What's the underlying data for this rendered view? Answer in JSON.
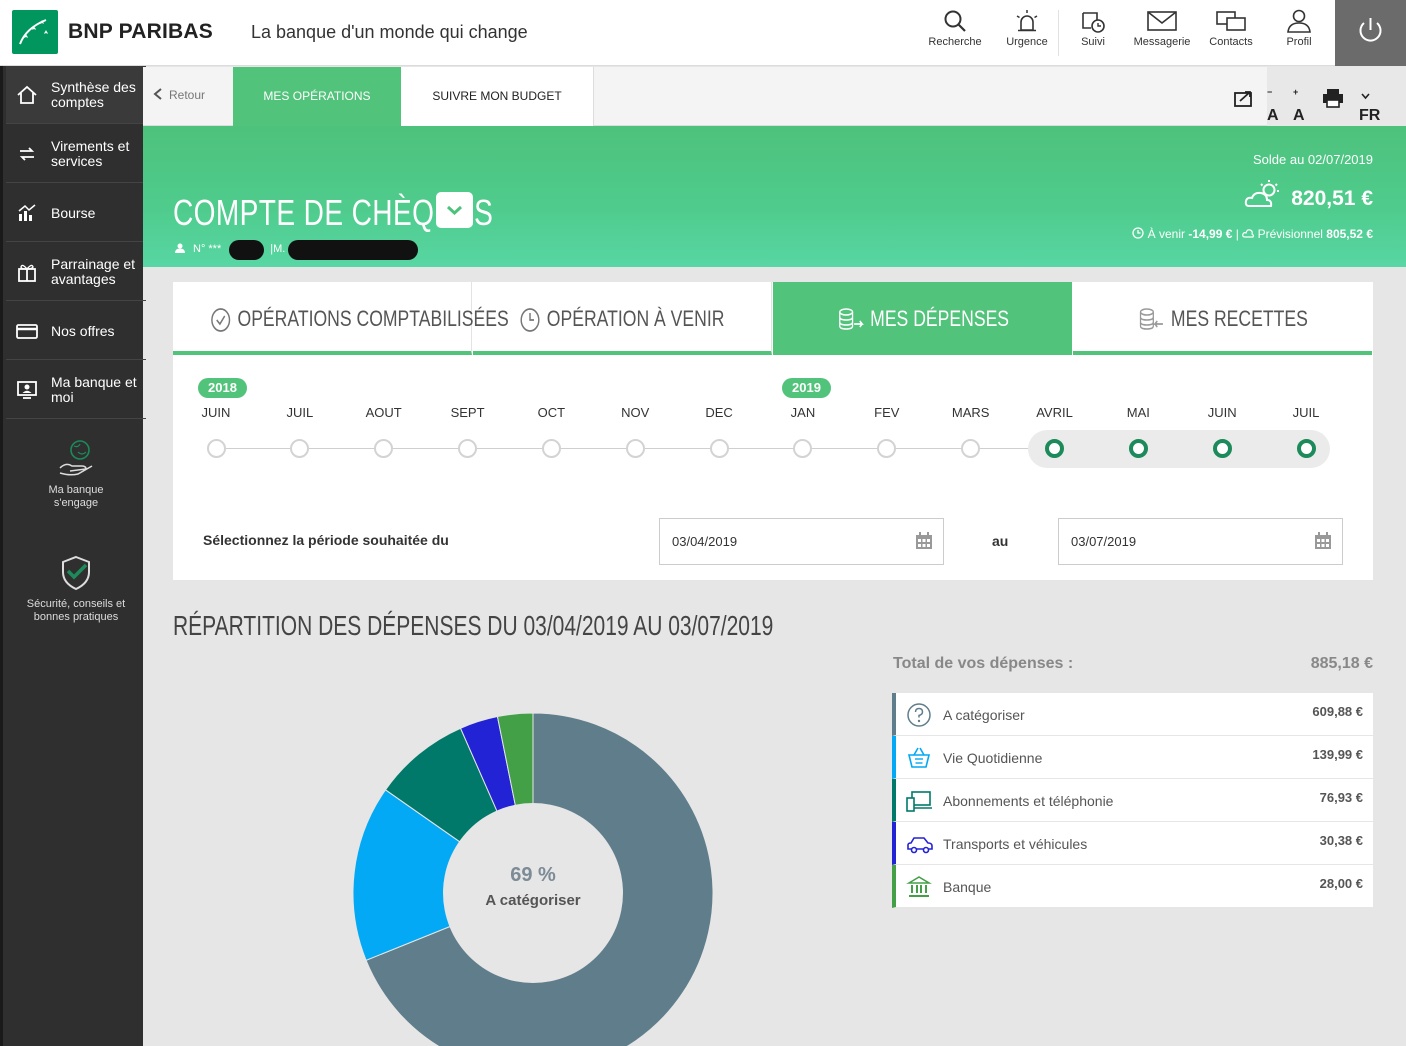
{
  "header": {
    "brand": "BNP PARIBAS",
    "tagline": "La banque d'un monde qui change",
    "nav": [
      {
        "label": "Recherche",
        "icon": "search-icon"
      },
      {
        "label": "Urgence",
        "icon": "alarm-icon"
      },
      {
        "label": "Suivi",
        "icon": "tracking-icon"
      },
      {
        "label": "Messagerie",
        "icon": "mail-icon"
      },
      {
        "label": "Contacts",
        "icon": "chat-icon"
      },
      {
        "label": "Profil",
        "icon": "user-icon"
      }
    ]
  },
  "sidebar": {
    "items": [
      {
        "label": "Synthèse des comptes",
        "icon": "home-icon"
      },
      {
        "label": "Virements et services",
        "icon": "transfer-icon"
      },
      {
        "label": "Bourse",
        "icon": "stock-chart-icon"
      },
      {
        "label": "Parrainage et avantages",
        "icon": "gift-icon"
      },
      {
        "label": "Nos offres",
        "icon": "card-icon"
      },
      {
        "label": "Ma banque et moi",
        "icon": "person-screen-icon"
      }
    ],
    "engage": "Ma banque s'engage",
    "security": "Sécurité, conseils et bonnes pratiques"
  },
  "subbar": {
    "back": "Retour",
    "tab_ops": "MES OPÉRATIONS",
    "tab_budget": "SUIVRE MON BUDGET",
    "font_small": "A",
    "font_big": "A",
    "lang": "FR"
  },
  "account": {
    "title": "COMPTE DE CHÈQUES",
    "num_prefix": "N° ***",
    "num_sep": "|M.",
    "solde_label": "Solde au 02/07/2019",
    "solde_value": "820,51 €",
    "avenir_label": "À venir",
    "avenir_value": "-14,99 €",
    "previsionnel_label": "Prévisionnel",
    "previsionnel_value": "805,52 €"
  },
  "op_tabs": [
    {
      "label": "OPÉRATIONS COMPTABILISÉES",
      "icon": "check-circle-icon"
    },
    {
      "label": "OPÉRATION À VENIR",
      "icon": "clock-icon"
    },
    {
      "label": "MES DÉPENSES",
      "icon": "coins-out-icon"
    },
    {
      "label": "MES RECETTES",
      "icon": "coins-in-icon"
    }
  ],
  "timeline": {
    "years": [
      "2018",
      "2019"
    ],
    "months": [
      "JUIN",
      "JUIL",
      "AOUT",
      "SEPT",
      "OCT",
      "NOV",
      "DEC",
      "JAN",
      "FEV",
      "MARS",
      "AVRIL",
      "MAI",
      "JUIN",
      "JUIL"
    ],
    "selected_from_index": 10,
    "selected_to_index": 13
  },
  "period": {
    "label": "Sélectionnez la période souhaitée du",
    "from": "03/04/2019",
    "au": "au",
    "to": "03/07/2019"
  },
  "repartition": {
    "title": "RÉPARTITION DES DÉPENSES DU 03/04/2019 AU 03/07/2019",
    "center_pct": "69 %",
    "center_label": "A catégoriser",
    "total_label": "Total de vos dépenses :",
    "total_value": "885,18 €"
  },
  "chart_data": {
    "type": "pie",
    "title": "",
    "categories": [
      "A catégoriser",
      "Vie Quotidienne",
      "Abonnements et téléphonie",
      "Transports et véhicules",
      "Banque"
    ],
    "values": [
      609.88,
      139.99,
      76.93,
      30.38,
      28.0
    ],
    "display_values": [
      "609,88 €",
      "139,99 €",
      "76,93 €",
      "30,38 €",
      "28,00 €"
    ],
    "colors": [
      "#607d8b",
      "#03a9f4",
      "#00796b",
      "#2323d6",
      "#43a047"
    ],
    "icons": [
      "question-circle-icon",
      "basket-icon",
      "devices-icon",
      "car-icon",
      "bank-icon"
    ]
  }
}
